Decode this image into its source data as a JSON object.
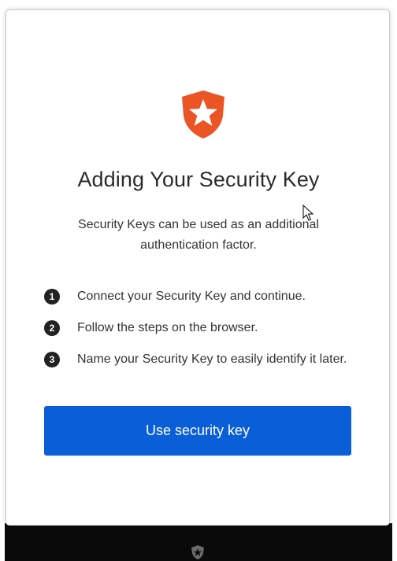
{
  "logo": {
    "icon": "auth0-shield-star-icon",
    "color": "#eb5424"
  },
  "title": "Adding Your Security Key",
  "description": "Security Keys can be used as an additional authentication factor.",
  "steps": [
    {
      "number": "1",
      "text": "Connect your Security Key and continue."
    },
    {
      "number": "2",
      "text": "Follow the steps on the browser."
    },
    {
      "number": "3",
      "text": "Name your Security Key to easily identify it later."
    }
  ],
  "button": {
    "label": "Use security key",
    "color": "#0a5fd8"
  },
  "footer": {
    "icon": "auth0-logo-icon"
  }
}
